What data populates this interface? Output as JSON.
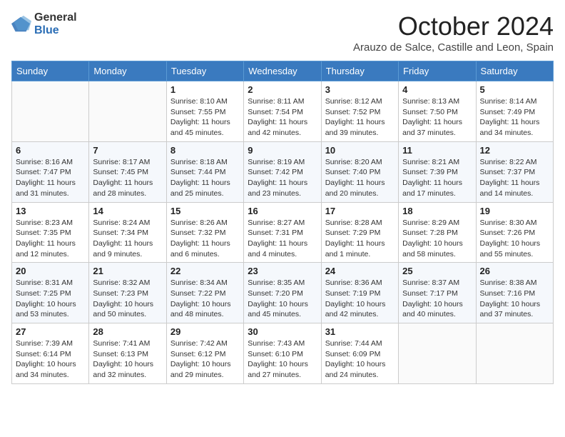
{
  "logo": {
    "general": "General",
    "blue": "Blue"
  },
  "title": "October 2024",
  "subtitle": "Arauzo de Salce, Castille and Leon, Spain",
  "days_of_week": [
    "Sunday",
    "Monday",
    "Tuesday",
    "Wednesday",
    "Thursday",
    "Friday",
    "Saturday"
  ],
  "weeks": [
    [
      {
        "day": "",
        "info": ""
      },
      {
        "day": "",
        "info": ""
      },
      {
        "day": "1",
        "info": "Sunrise: 8:10 AM\nSunset: 7:55 PM\nDaylight: 11 hours and 45 minutes."
      },
      {
        "day": "2",
        "info": "Sunrise: 8:11 AM\nSunset: 7:54 PM\nDaylight: 11 hours and 42 minutes."
      },
      {
        "day": "3",
        "info": "Sunrise: 8:12 AM\nSunset: 7:52 PM\nDaylight: 11 hours and 39 minutes."
      },
      {
        "day": "4",
        "info": "Sunrise: 8:13 AM\nSunset: 7:50 PM\nDaylight: 11 hours and 37 minutes."
      },
      {
        "day": "5",
        "info": "Sunrise: 8:14 AM\nSunset: 7:49 PM\nDaylight: 11 hours and 34 minutes."
      }
    ],
    [
      {
        "day": "6",
        "info": "Sunrise: 8:16 AM\nSunset: 7:47 PM\nDaylight: 11 hours and 31 minutes."
      },
      {
        "day": "7",
        "info": "Sunrise: 8:17 AM\nSunset: 7:45 PM\nDaylight: 11 hours and 28 minutes."
      },
      {
        "day": "8",
        "info": "Sunrise: 8:18 AM\nSunset: 7:44 PM\nDaylight: 11 hours and 25 minutes."
      },
      {
        "day": "9",
        "info": "Sunrise: 8:19 AM\nSunset: 7:42 PM\nDaylight: 11 hours and 23 minutes."
      },
      {
        "day": "10",
        "info": "Sunrise: 8:20 AM\nSunset: 7:40 PM\nDaylight: 11 hours and 20 minutes."
      },
      {
        "day": "11",
        "info": "Sunrise: 8:21 AM\nSunset: 7:39 PM\nDaylight: 11 hours and 17 minutes."
      },
      {
        "day": "12",
        "info": "Sunrise: 8:22 AM\nSunset: 7:37 PM\nDaylight: 11 hours and 14 minutes."
      }
    ],
    [
      {
        "day": "13",
        "info": "Sunrise: 8:23 AM\nSunset: 7:35 PM\nDaylight: 11 hours and 12 minutes."
      },
      {
        "day": "14",
        "info": "Sunrise: 8:24 AM\nSunset: 7:34 PM\nDaylight: 11 hours and 9 minutes."
      },
      {
        "day": "15",
        "info": "Sunrise: 8:26 AM\nSunset: 7:32 PM\nDaylight: 11 hours and 6 minutes."
      },
      {
        "day": "16",
        "info": "Sunrise: 8:27 AM\nSunset: 7:31 PM\nDaylight: 11 hours and 4 minutes."
      },
      {
        "day": "17",
        "info": "Sunrise: 8:28 AM\nSunset: 7:29 PM\nDaylight: 11 hours and 1 minute."
      },
      {
        "day": "18",
        "info": "Sunrise: 8:29 AM\nSunset: 7:28 PM\nDaylight: 10 hours and 58 minutes."
      },
      {
        "day": "19",
        "info": "Sunrise: 8:30 AM\nSunset: 7:26 PM\nDaylight: 10 hours and 55 minutes."
      }
    ],
    [
      {
        "day": "20",
        "info": "Sunrise: 8:31 AM\nSunset: 7:25 PM\nDaylight: 10 hours and 53 minutes."
      },
      {
        "day": "21",
        "info": "Sunrise: 8:32 AM\nSunset: 7:23 PM\nDaylight: 10 hours and 50 minutes."
      },
      {
        "day": "22",
        "info": "Sunrise: 8:34 AM\nSunset: 7:22 PM\nDaylight: 10 hours and 48 minutes."
      },
      {
        "day": "23",
        "info": "Sunrise: 8:35 AM\nSunset: 7:20 PM\nDaylight: 10 hours and 45 minutes."
      },
      {
        "day": "24",
        "info": "Sunrise: 8:36 AM\nSunset: 7:19 PM\nDaylight: 10 hours and 42 minutes."
      },
      {
        "day": "25",
        "info": "Sunrise: 8:37 AM\nSunset: 7:17 PM\nDaylight: 10 hours and 40 minutes."
      },
      {
        "day": "26",
        "info": "Sunrise: 8:38 AM\nSunset: 7:16 PM\nDaylight: 10 hours and 37 minutes."
      }
    ],
    [
      {
        "day": "27",
        "info": "Sunrise: 7:39 AM\nSunset: 6:14 PM\nDaylight: 10 hours and 34 minutes."
      },
      {
        "day": "28",
        "info": "Sunrise: 7:41 AM\nSunset: 6:13 PM\nDaylight: 10 hours and 32 minutes."
      },
      {
        "day": "29",
        "info": "Sunrise: 7:42 AM\nSunset: 6:12 PM\nDaylight: 10 hours and 29 minutes."
      },
      {
        "day": "30",
        "info": "Sunrise: 7:43 AM\nSunset: 6:10 PM\nDaylight: 10 hours and 27 minutes."
      },
      {
        "day": "31",
        "info": "Sunrise: 7:44 AM\nSunset: 6:09 PM\nDaylight: 10 hours and 24 minutes."
      },
      {
        "day": "",
        "info": ""
      },
      {
        "day": "",
        "info": ""
      }
    ]
  ]
}
